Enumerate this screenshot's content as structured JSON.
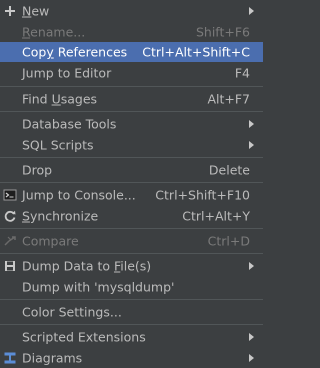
{
  "items": [
    {
      "pre": "",
      "u": "N",
      "post": "ew",
      "shortcut": "",
      "submenu": true
    },
    {
      "pre": "",
      "u": "R",
      "post": "ename...",
      "shortcut": "Shift+F6",
      "submenu": false
    },
    {
      "pre": "Cop",
      "u": "y",
      "post": " References",
      "shortcut": "Ctrl+Alt+Shift+C",
      "submenu": false
    },
    {
      "pre": "Jump to Editor",
      "u": "",
      "post": "",
      "shortcut": "F4",
      "submenu": false
    },
    {
      "pre": "Find ",
      "u": "U",
      "post": "sages",
      "shortcut": "Alt+F7",
      "submenu": false
    },
    {
      "pre": "Database Tools",
      "u": "",
      "post": "",
      "shortcut": "",
      "submenu": true
    },
    {
      "pre": "SQL Scripts",
      "u": "",
      "post": "",
      "shortcut": "",
      "submenu": true
    },
    {
      "pre": "Drop",
      "u": "",
      "post": "",
      "shortcut": "Delete",
      "submenu": false
    },
    {
      "pre": "",
      "u": "J",
      "post": "ump to Console...",
      "shortcut": "Ctrl+Shift+F10",
      "submenu": false
    },
    {
      "pre": "",
      "u": "S",
      "post": "ynchronize",
      "shortcut": "Ctrl+Alt+Y",
      "submenu": false
    },
    {
      "pre": "Compare",
      "u": "",
      "post": "",
      "shortcut": "Ctrl+D",
      "submenu": false
    },
    {
      "pre": "Dump Data to ",
      "u": "F",
      "post": "ile(s)",
      "shortcut": "",
      "submenu": true
    },
    {
      "pre": "Dump with 'mysqldump'",
      "u": "",
      "post": "",
      "shortcut": "",
      "submenu": false
    },
    {
      "pre": "Color Settings...",
      "u": "",
      "post": "",
      "shortcut": "",
      "submenu": false
    },
    {
      "pre": "Scripted Extensions",
      "u": "",
      "post": "",
      "shortcut": "",
      "submenu": true
    },
    {
      "pre": "Diagrams",
      "u": "",
      "post": "",
      "shortcut": "",
      "submenu": true
    }
  ],
  "icons": {
    "new": "plus-icon",
    "jump_to_console": "console-icon",
    "synchronize": "sync-icon",
    "compare": "compare-icon",
    "dump_data": "save-icon",
    "diagrams": "diagram-icon"
  },
  "colors": {
    "background": "#3c3f41",
    "selection": "#4b6eaf",
    "text": "#bbbbbb",
    "disabled_text": "#7a7a7a",
    "separator": "#515658"
  }
}
